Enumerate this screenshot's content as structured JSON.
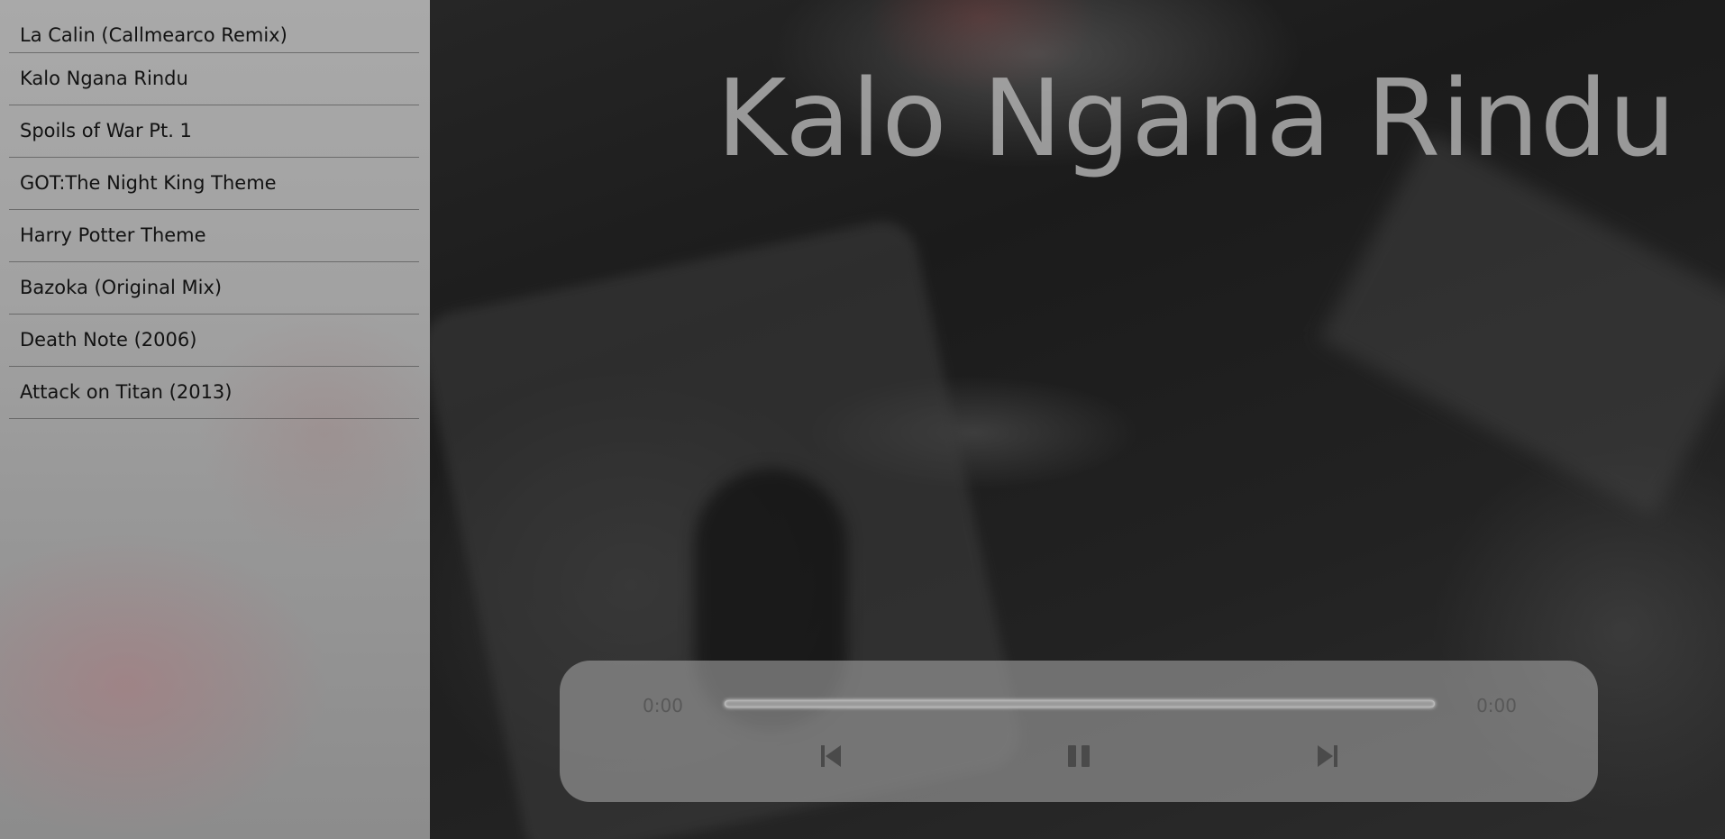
{
  "playlist": {
    "items": [
      {
        "label": "La Calin (Callmearco Remix)"
      },
      {
        "label": "Kalo Ngana Rindu"
      },
      {
        "label": "Spoils of War Pt. 1"
      },
      {
        "label": "GOT:The Night King Theme"
      },
      {
        "label": "Harry Potter Theme"
      },
      {
        "label": "Bazoka (Original Mix)"
      },
      {
        "label": "Death Note (2006)"
      },
      {
        "label": "Attack on Titan (2013)"
      }
    ]
  },
  "now_playing": {
    "title": "Kalo Ngana Rindu"
  },
  "player": {
    "current_time": "0:00",
    "total_time": "0:00",
    "progress_fraction": 0,
    "controls": {
      "previous_icon": "skip-previous-icon",
      "pause_icon": "pause-icon",
      "next_icon": "skip-next-icon"
    }
  },
  "colors": {
    "sidebar_bg": "#a4a4a4",
    "player_bg": "#a0a0a0",
    "title_text": "#afafaf",
    "icon": "#4a4a4a"
  }
}
